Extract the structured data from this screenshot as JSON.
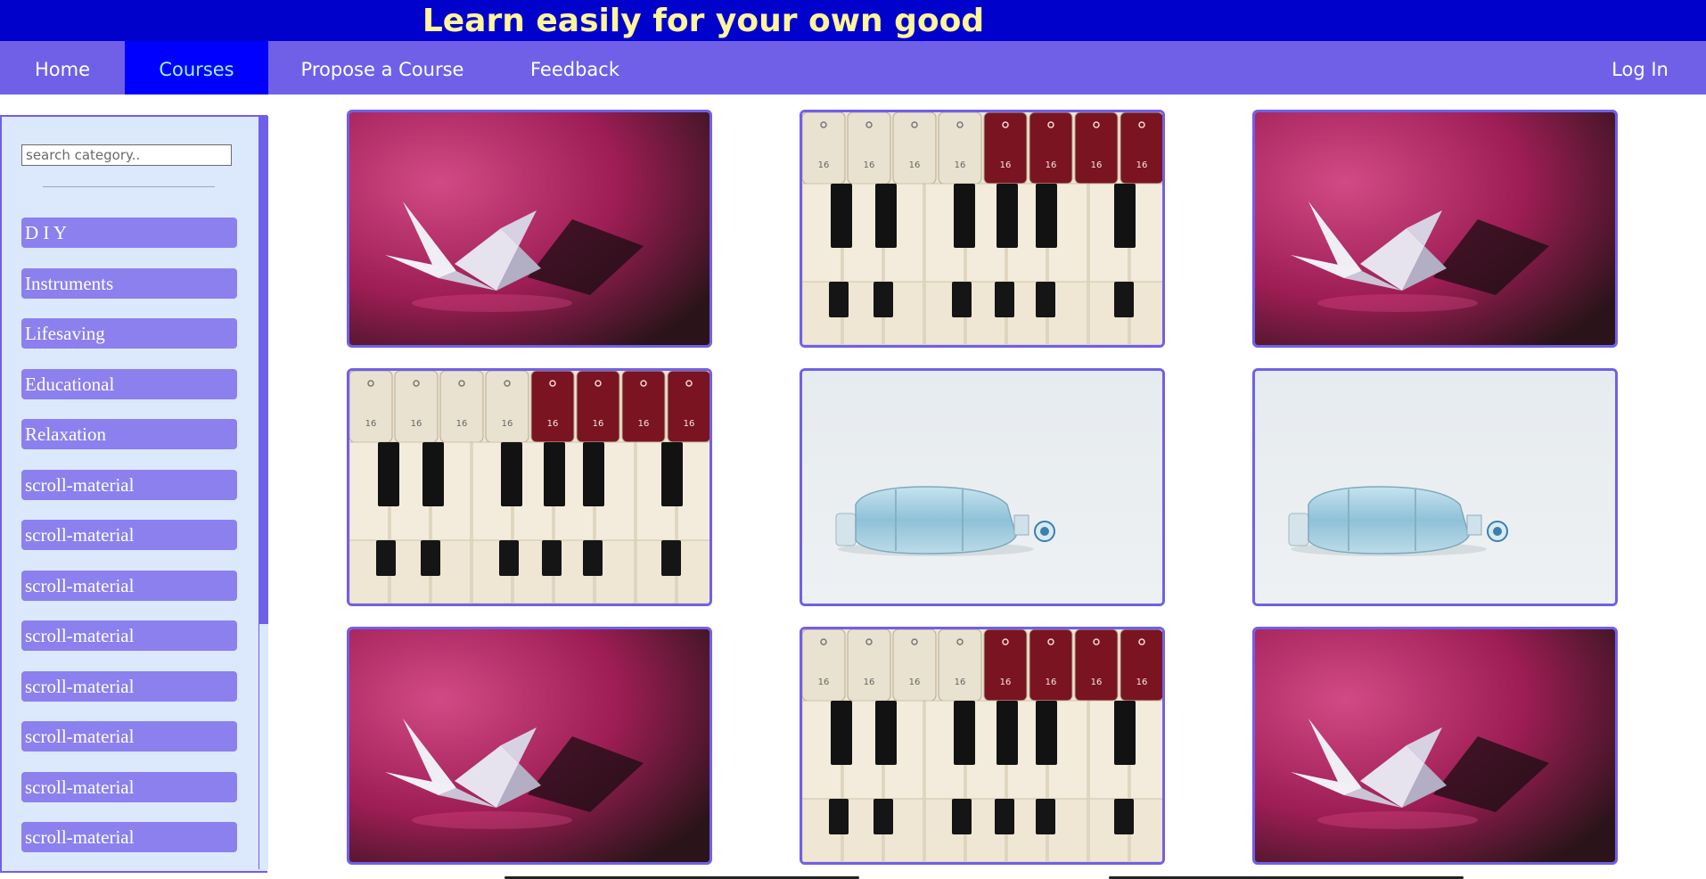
{
  "header": {
    "title": "Learn easily for your own good"
  },
  "nav": {
    "items": [
      "Home",
      "Courses",
      "Propose a Course",
      "Feedback"
    ],
    "active": "Courses",
    "login": "Log In"
  },
  "sidebar": {
    "search_placeholder": "search category..",
    "categories": [
      "D I Y",
      "Instruments",
      "Lifesaving",
      "Educational",
      "Relaxation",
      "scroll-material",
      "scroll-material",
      "scroll-material",
      "scroll-material",
      "scroll-material",
      "scroll-material",
      "scroll-material",
      "scroll-material"
    ]
  },
  "courses": {
    "tiles": [
      {
        "image": "origami-crane"
      },
      {
        "image": "organ-keys"
      },
      {
        "image": "origami-crane"
      },
      {
        "image": "organ-keys"
      },
      {
        "image": "resuscitator-bag"
      },
      {
        "image": "resuscitator-bag"
      },
      {
        "image": "origami-crane"
      },
      {
        "image": "organ-keys"
      },
      {
        "image": "origami-crane"
      }
    ]
  },
  "colors": {
    "banner": "#0101cc",
    "banner_text": "#fff59a",
    "nav": "#7060e8",
    "nav_active": "#0000ff",
    "nav_active_text": "#9ef0ff",
    "sidebar_bg": "#dce8fb",
    "category_button": "#8c80ee"
  }
}
